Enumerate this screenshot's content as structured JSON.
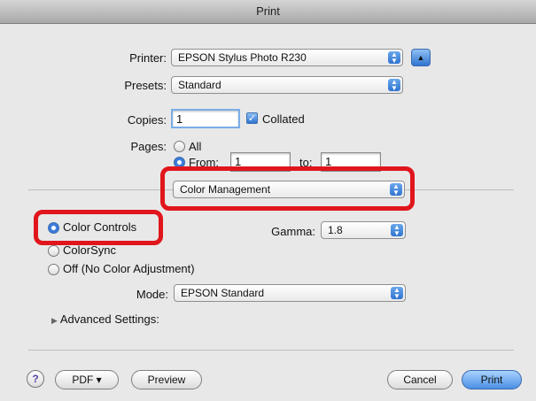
{
  "window": {
    "title": "Print"
  },
  "printer": {
    "label": "Printer:",
    "value": "EPSON Stylus Photo R230"
  },
  "presets": {
    "label": "Presets:",
    "value": "Standard"
  },
  "copies": {
    "label": "Copies:",
    "value": "1",
    "collated_label": "Collated",
    "collated_checked": true
  },
  "pages": {
    "label": "Pages:",
    "all_label": "All",
    "from_label": "From:",
    "from_value": "1",
    "to_label": "to:",
    "to_value": "1",
    "selected": "from"
  },
  "panel": {
    "value": "Color Management"
  },
  "color": {
    "options": [
      "Color Controls",
      "ColorSync",
      "Off (No Color Adjustment)"
    ],
    "selected": "Color Controls",
    "gamma_label": "Gamma:",
    "gamma_value": "1.8",
    "mode_label": "Mode:",
    "mode_value": "EPSON Standard",
    "advanced_label": "Advanced Settings:"
  },
  "footer": {
    "help": "?",
    "pdf": "PDF ▾",
    "preview": "Preview",
    "cancel": "Cancel",
    "print": "Print"
  },
  "annotations": {
    "highlight_color": "#e0161c"
  }
}
